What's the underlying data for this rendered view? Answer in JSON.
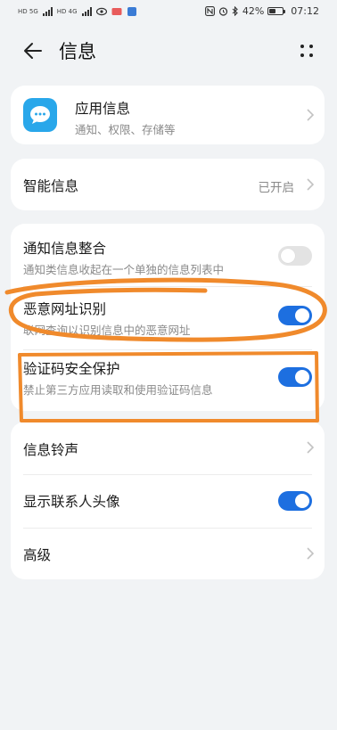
{
  "status_bar": {
    "sim1_label": "HD 5G",
    "sim2_label": "HD 4G",
    "battery_text": "42%",
    "time": "07:12",
    "icons": [
      "nfc-icon",
      "alarm-icon",
      "bluetooth-icon",
      "battery-icon"
    ]
  },
  "header": {
    "title": "信息",
    "back_icon": "arrow-left-icon",
    "more_icon": "more-dots-icon"
  },
  "app_info": {
    "title": "应用信息",
    "subtitle": "通知、权限、存储等"
  },
  "smart_info": {
    "title": "智能信息",
    "value": "已开启"
  },
  "notifications": {
    "merge": {
      "title": "通知信息整合",
      "subtitle": "通知类信息收起在一个单独的信息列表中",
      "enabled": false
    },
    "malicious_url": {
      "title": "恶意网址识别",
      "subtitle": "联网查询以识别信息中的恶意网址",
      "enabled": true
    },
    "otp_protection": {
      "title": "验证码安全保护",
      "subtitle": "禁止第三方应用读取和使用验证码信息",
      "enabled": true
    }
  },
  "misc": {
    "ringtone": {
      "title": "信息铃声"
    },
    "contact_avatar": {
      "title": "显示联系人头像",
      "enabled": true
    },
    "advanced": {
      "title": "高级"
    }
  },
  "colors": {
    "accent": "#1d6fe0",
    "annotation": "#f08a2c",
    "background": "#f1f3f5"
  }
}
